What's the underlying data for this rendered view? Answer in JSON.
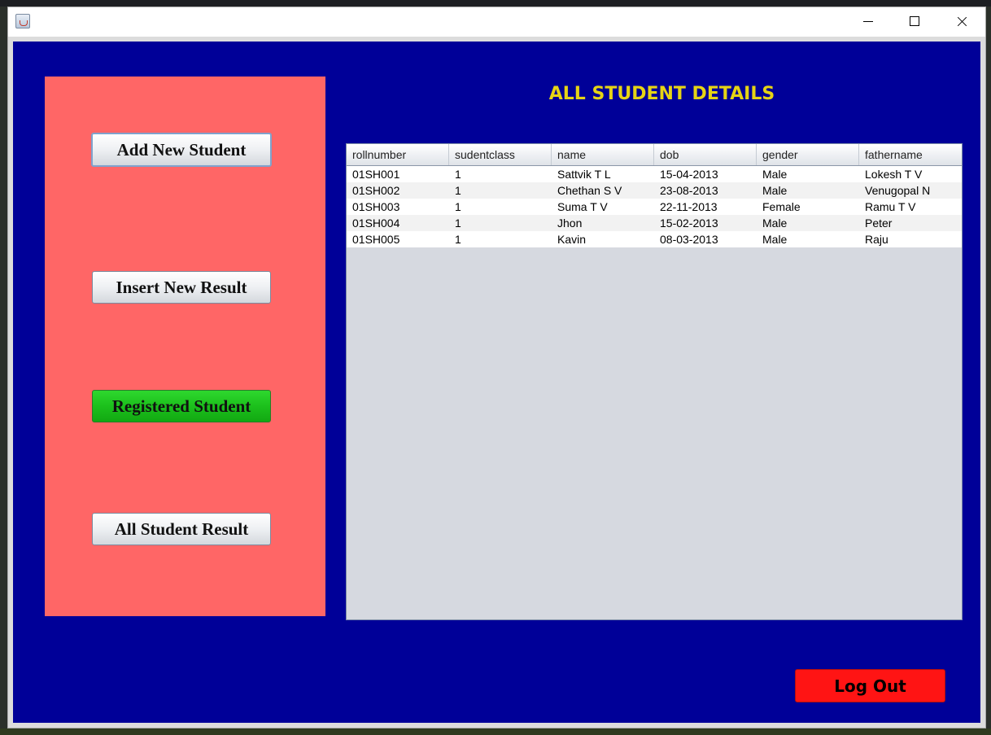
{
  "window": {
    "controls": [
      "minimize-icon",
      "maximize-icon",
      "close-icon"
    ]
  },
  "sidebar": {
    "buttons": [
      {
        "label": "Add New Student"
      },
      {
        "label": "Insert New Result"
      },
      {
        "label": "Registered Student",
        "active": true
      },
      {
        "label": "All Student Result"
      }
    ]
  },
  "main": {
    "title": "ALL STUDENT DETAILS",
    "table": {
      "columns": [
        "rollnumber",
        "sudentclass",
        "name",
        "dob",
        "gender",
        "fathername"
      ],
      "rows": [
        [
          "01SH001",
          "1",
          "Sattvik T L",
          "15-04-2013",
          "Male",
          "Lokesh T V"
        ],
        [
          "01SH002",
          "1",
          "Chethan S V",
          "23-08-2013",
          "Male",
          "Venugopal N"
        ],
        [
          "01SH003",
          "1",
          "Suma T V",
          "22-11-2013",
          "Female",
          "Ramu T V"
        ],
        [
          "01SH004",
          "1",
          "Jhon",
          "15-02-2013",
          "Male",
          "Peter"
        ],
        [
          "01SH005",
          "1",
          "Kavin",
          "08-03-2013",
          "Male",
          "Raju"
        ]
      ]
    }
  },
  "footer": {
    "logout_label": "Log Out"
  },
  "colors": {
    "background": "#000098",
    "sidebar": "#ff6666",
    "active_button": "#1cc01c",
    "title": "#e6d415",
    "logout": "#ff1414"
  }
}
